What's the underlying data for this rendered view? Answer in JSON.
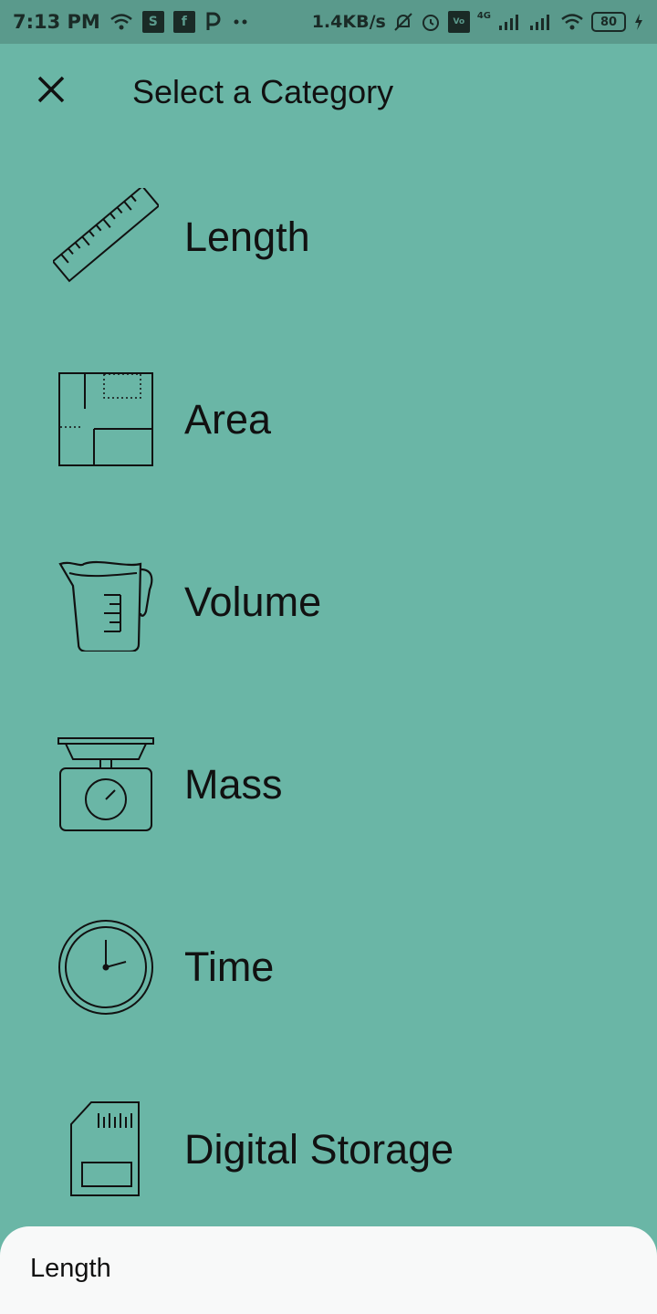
{
  "status_bar": {
    "time": "7:13 PM",
    "network_speed": "1.4KB/s",
    "network_type": "4G",
    "battery_level": "80",
    "icons": [
      "wifi-icon",
      "instagram-s-icon",
      "facebook-icon",
      "paytm-icon",
      "more-dots-icon",
      "muted-bell-icon",
      "alarm-icon",
      "volte-icon",
      "signal-icon",
      "signal-icon",
      "wifi-icon",
      "battery-icon",
      "charging-icon"
    ]
  },
  "header": {
    "close_icon": "close-icon",
    "title": "Select a Category"
  },
  "categories": [
    {
      "label": "Length",
      "icon": "ruler-icon"
    },
    {
      "label": "Area",
      "icon": "floor-plan-icon"
    },
    {
      "label": "Volume",
      "icon": "measuring-cup-icon"
    },
    {
      "label": "Mass",
      "icon": "weighing-scale-icon"
    },
    {
      "label": "Time",
      "icon": "clock-icon"
    },
    {
      "label": "Digital Storage",
      "icon": "sd-card-icon"
    }
  ],
  "bottom_sheet": {
    "selected_label": "Length"
  },
  "colors": {
    "background": "#6ab6a6",
    "status_bar": "#5a9a8c",
    "sheet": "#f8f9f9",
    "text": "#111111"
  }
}
